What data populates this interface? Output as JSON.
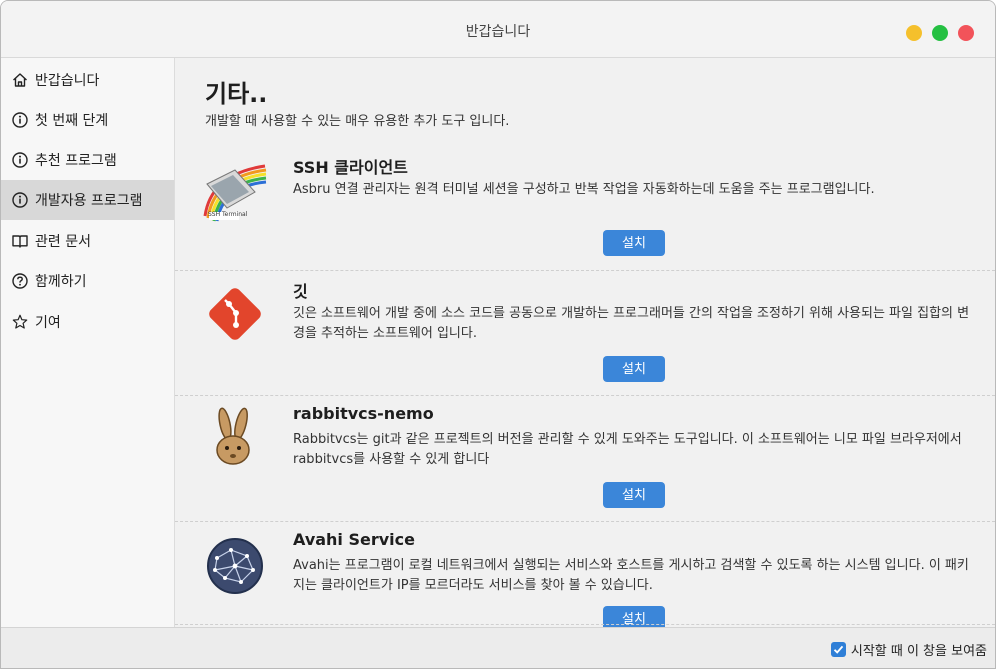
{
  "window": {
    "title": "반갑습니다"
  },
  "sidebar": {
    "items": [
      {
        "label": "반갑습니다",
        "icon": "home-icon"
      },
      {
        "label": "첫 번째 단계",
        "icon": "info-circle-icon"
      },
      {
        "label": "추천 프로그램",
        "icon": "info-circle-icon"
      },
      {
        "label": "개발자용 프로그램",
        "icon": "info-circle-icon",
        "active": true
      },
      {
        "label": "관련 문서",
        "icon": "book-icon"
      },
      {
        "label": "함께하기",
        "icon": "help-circle-icon"
      },
      {
        "label": "기여",
        "icon": "star-icon"
      }
    ]
  },
  "main": {
    "title": "기타..",
    "description": "개발할 때 사용할 수 있는 매우 유용한 추가 도구 입니다.",
    "apps": [
      {
        "name": "SSH 클라이언트",
        "description": "Asbru 연결 관리자는 원격 터미널 세션을 구성하고 반복 작업을 자동화하는데 도움을 주는 프로그램입니다.",
        "install_label": "설치",
        "icon": "ssh-terminal-icon",
        "icon_text": "SSH Terminal"
      },
      {
        "name": "깃",
        "description": "깃은 소프트웨어 개발 중에 소스 코드를 공동으로 개발하는 프로그래머들 간의 작업을 조정하기 위해 사용되는 파일 집합의 변경을 추적하는 소프트웨어 입니다.",
        "install_label": "설치",
        "icon": "git-icon"
      },
      {
        "name": "rabbitvcs-nemo",
        "description": "Rabbitvcs는 git과 같은 프로젝트의 버전을 관리할 수 있게 도와주는 도구입니다. 이 소프트웨어는 니모 파일 브라우저에서 rabbitvcs를 사용할 수 있게 합니다",
        "install_label": "설치",
        "icon": "rabbit-icon"
      },
      {
        "name": "Avahi Service",
        "description": "Avahi는 프로그램이 로컬 네트워크에서 실행되는 서비스와 호스트를 게시하고 검색할 수 있도록 하는 시스템 입니다. 이 패키지는 클라이언트가 IP를 모르더라도 서비스를 찾아 볼 수 있습니다.",
        "install_label": "설치",
        "icon": "network-globe-icon"
      }
    ]
  },
  "footer": {
    "checkbox_label": "시작할 때 이 창을 보여줌",
    "checked": true
  },
  "colors": {
    "accent": "#3b86d9",
    "close": "#f2535a",
    "minimize": "#f5c02c",
    "maximize": "#25c042"
  }
}
